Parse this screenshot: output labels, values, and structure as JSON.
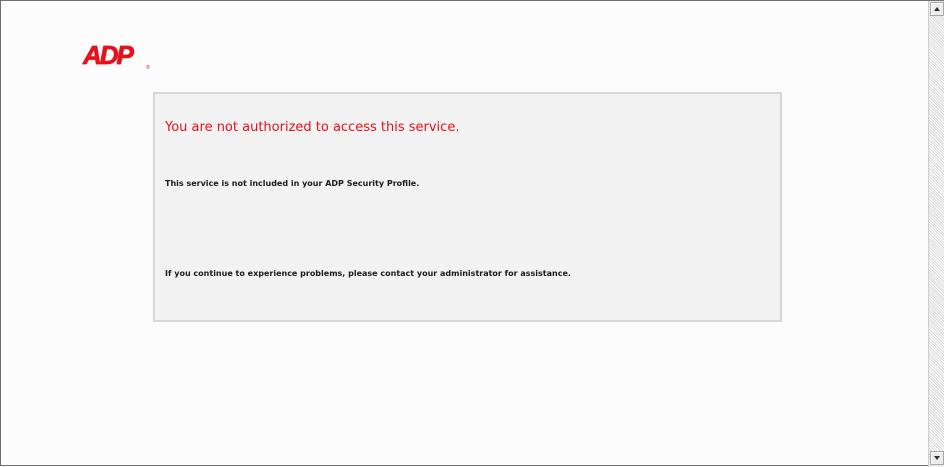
{
  "brand": {
    "logo_text": "ADP",
    "logo_color": "#e8101a",
    "registered_mark": "®"
  },
  "error": {
    "title": "You are not authorized to access this service.",
    "detail": "This service is not included in your ADP Security Profile.",
    "help": "If you continue to experience problems, please contact your administrator for assistance."
  },
  "colors": {
    "title_red": "#e8101a",
    "panel_bg": "#f2f2f2",
    "panel_border": "#d6d6d6"
  },
  "scrollbar": {
    "up_icon": "arrow-up-icon",
    "down_icon": "arrow-down-icon"
  }
}
